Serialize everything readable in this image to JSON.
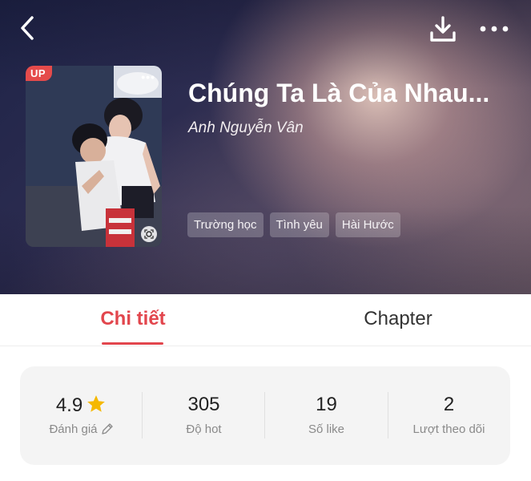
{
  "book": {
    "title": "Chúng Ta Là Của Nhau...",
    "author": "Anh Nguyễn Vân",
    "badge": "UP",
    "tags": [
      "Trường học",
      "Tình yêu",
      "Hài Hước"
    ]
  },
  "tabs": [
    {
      "label": "Chi tiết",
      "active": true
    },
    {
      "label": "Chapter",
      "active": false
    }
  ],
  "stats": {
    "rating": {
      "value": "4.9",
      "label": "Đánh giá"
    },
    "hot": {
      "value": "305",
      "label": "Độ hot"
    },
    "likes": {
      "value": "19",
      "label": "Số like"
    },
    "followers": {
      "value": "2",
      "label": "Lượt theo dõi"
    }
  },
  "icons": {
    "back": "back-arrow-icon",
    "download": "download-icon",
    "more": "more-dots-icon",
    "star": "star-icon",
    "edit": "pencil-icon"
  },
  "colors": {
    "accent": "#e2464d",
    "badge": "#e54b4b",
    "star": "#f5b800"
  }
}
